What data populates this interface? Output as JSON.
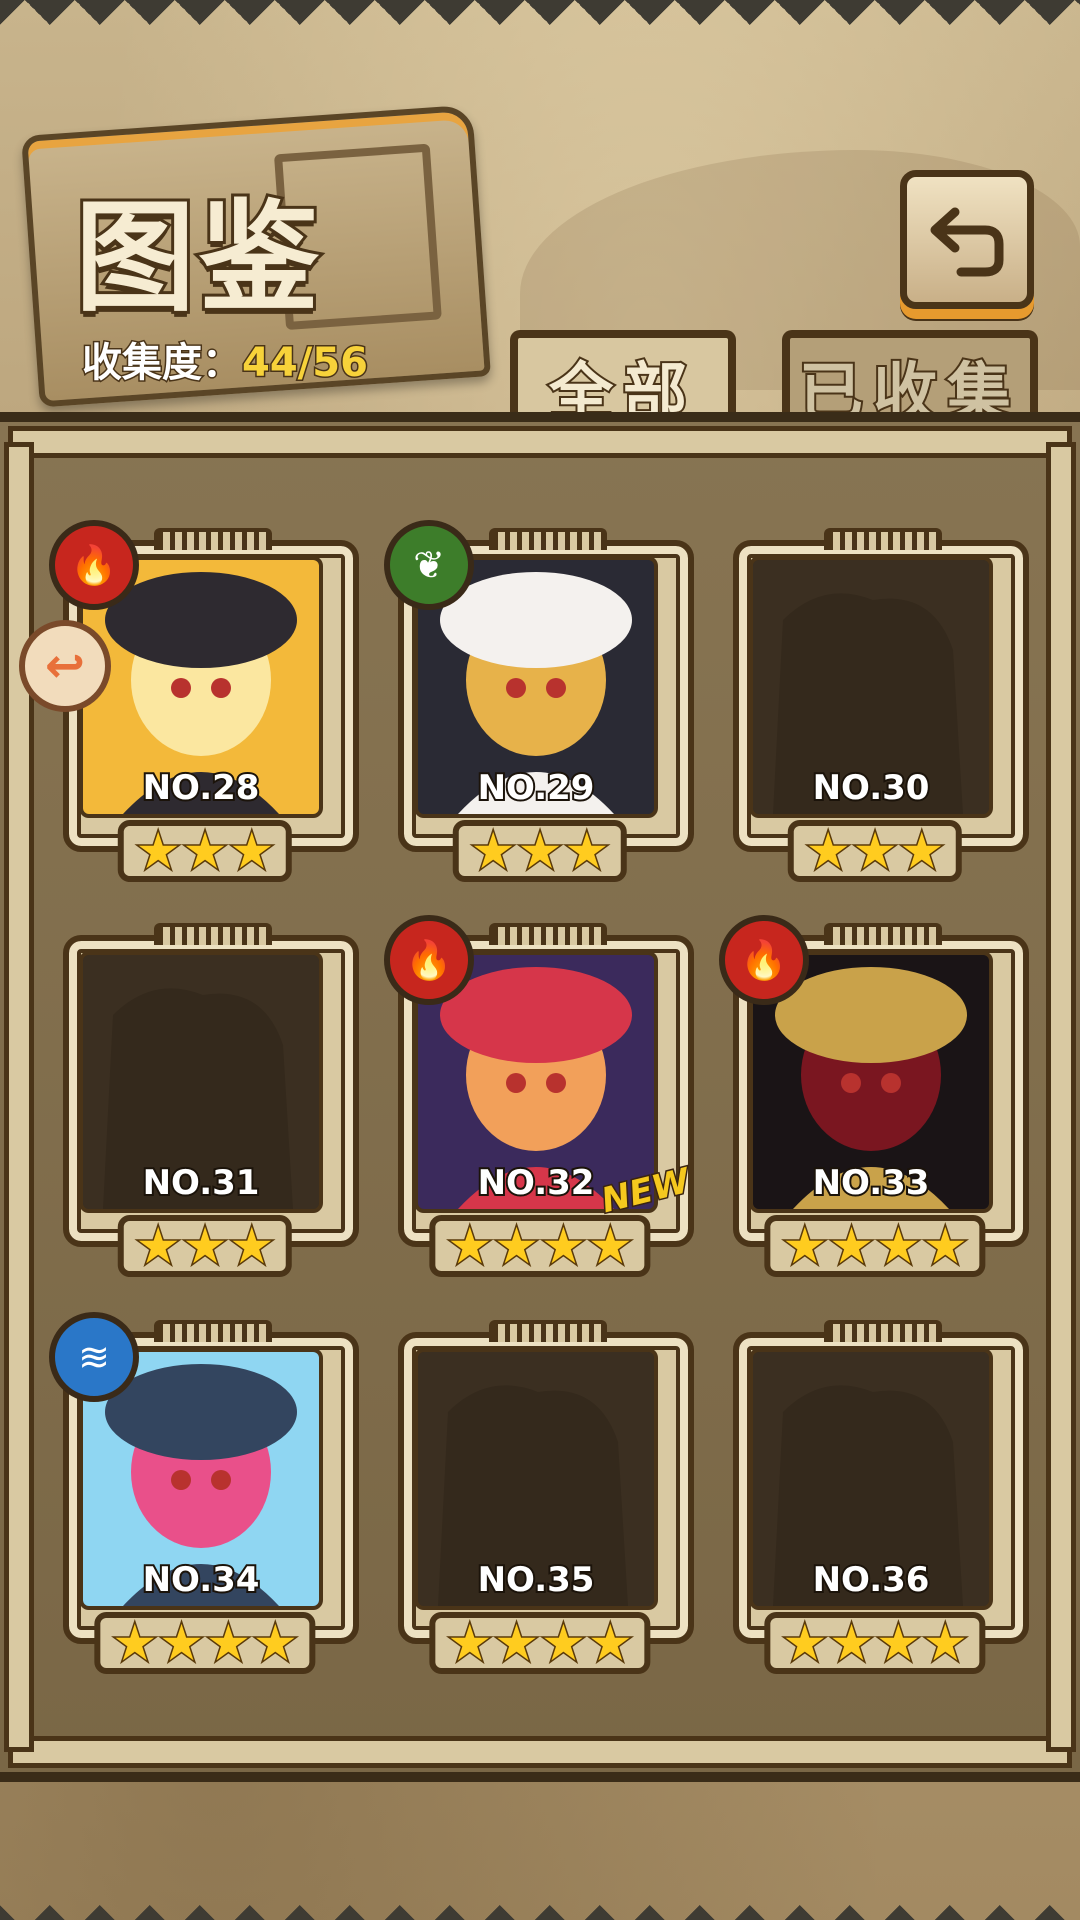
{
  "header": {
    "title": "图鉴",
    "collection_label": "收集度：",
    "collection_value": "44/56"
  },
  "tabs": [
    {
      "label": "全部",
      "active": true
    },
    {
      "label": "已收集",
      "active": false
    }
  ],
  "colors": {
    "fire": "#c7261e",
    "leaf": "#3d7d2a",
    "water": "#2a77c8",
    "frame": "#d9c9a2",
    "outline": "#4a3418",
    "collection_value": "#f7d23a",
    "star": "#ffcc1f"
  },
  "cards": [
    {
      "no": "NO.28",
      "stars": 3,
      "element": "fire",
      "collected": true,
      "extra_badge": true
    },
    {
      "no": "NO.29",
      "stars": 3,
      "element": "leaf",
      "collected": true
    },
    {
      "no": "NO.30",
      "stars": 3,
      "element": null,
      "collected": false
    },
    {
      "no": "NO.31",
      "stars": 3,
      "element": null,
      "collected": false
    },
    {
      "no": "NO.32",
      "stars": 4,
      "element": "fire",
      "collected": true,
      "new_tag": "NEW"
    },
    {
      "no": "NO.33",
      "stars": 4,
      "element": "fire",
      "collected": true
    },
    {
      "no": "NO.34",
      "stars": 4,
      "element": "water",
      "collected": true
    },
    {
      "no": "NO.35",
      "stars": 4,
      "element": null,
      "collected": false
    },
    {
      "no": "NO.36",
      "stars": 4,
      "element": null,
      "collected": false
    }
  ]
}
